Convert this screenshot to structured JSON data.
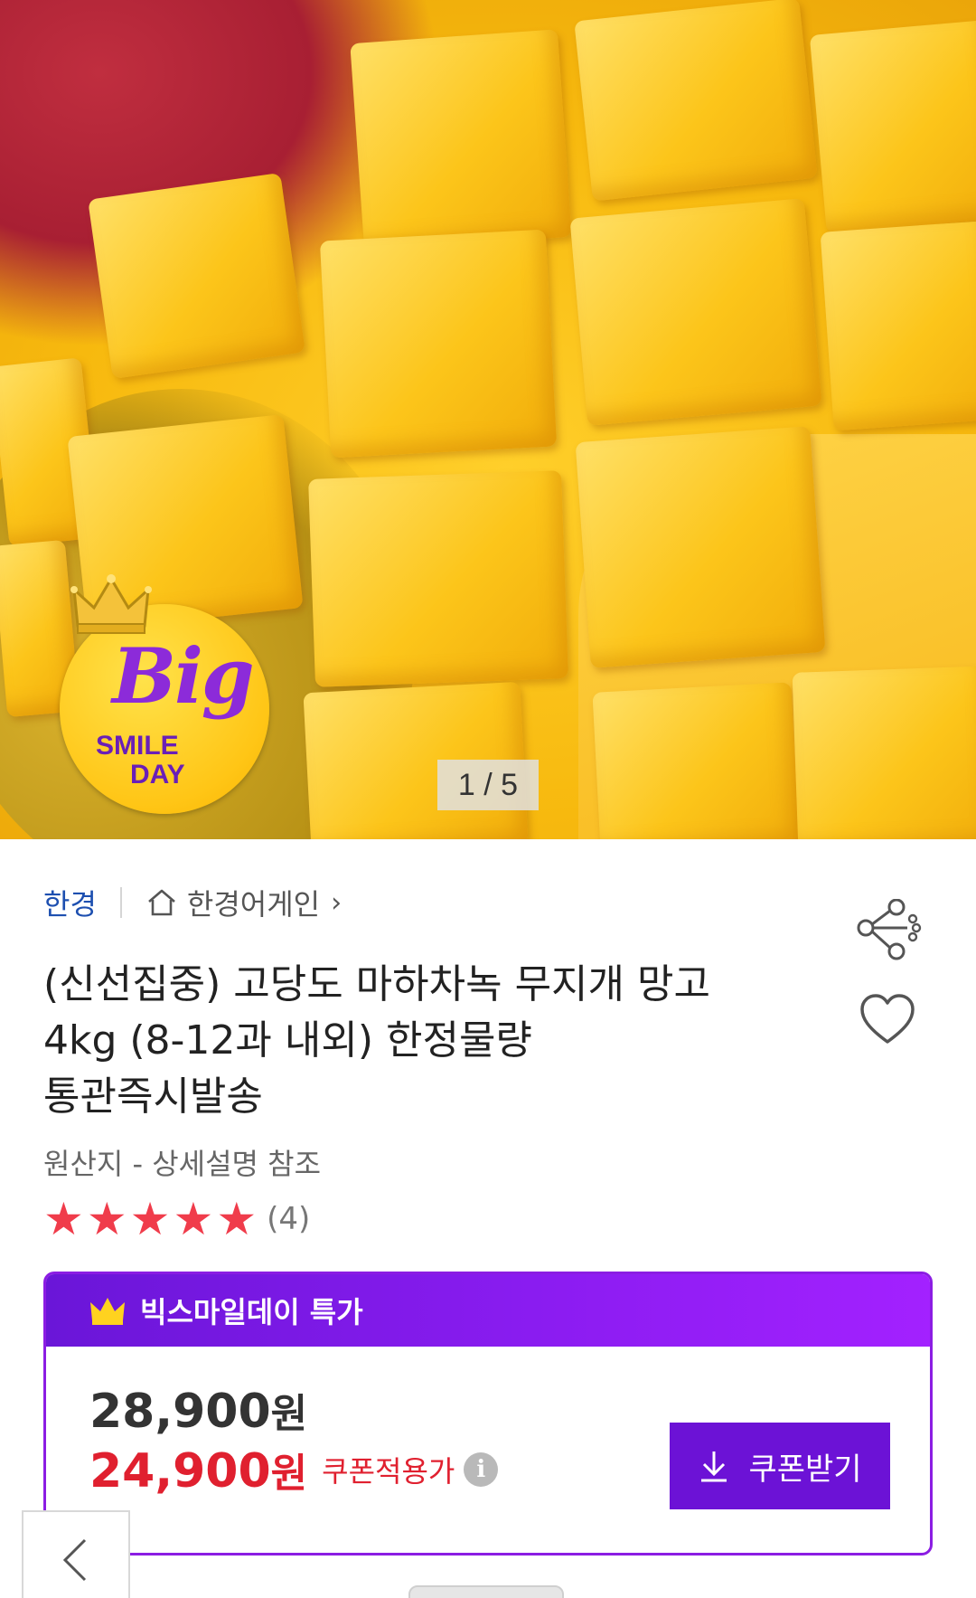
{
  "hero": {
    "pager": "1 / 5",
    "badge": {
      "big": "Big",
      "line1": "SMILE",
      "line2": "DAY"
    },
    "icon": "crown-icon"
  },
  "seller": {
    "brand": "한경",
    "store_icon": "home-icon",
    "store_name": "한경어게인",
    "chevron": "›"
  },
  "actions": {
    "share_icon": "share-icon",
    "wish_icon": "heart-icon"
  },
  "product": {
    "title_lines": [
      "(신선집중) 고당도 마하차녹 무지개 망고",
      "4kg (8-12과 내외) 한정물량",
      "통관즉시발송"
    ],
    "origin": "원산지 - 상세설명 참조",
    "rating": {
      "stars": 5,
      "review_count": "(4)"
    }
  },
  "deal": {
    "title": "빅스마일데이 특가",
    "original_price": "28,900",
    "sale_price": "24,900",
    "currency": "원",
    "coupon_note": "쿠폰적용가",
    "info_glyph": "i",
    "coupon_button": "쿠폰받기",
    "accent_color": "#8b1de3",
    "sale_color": "#e0202f"
  },
  "nav": {
    "back_icon": "chevron-left-icon"
  }
}
